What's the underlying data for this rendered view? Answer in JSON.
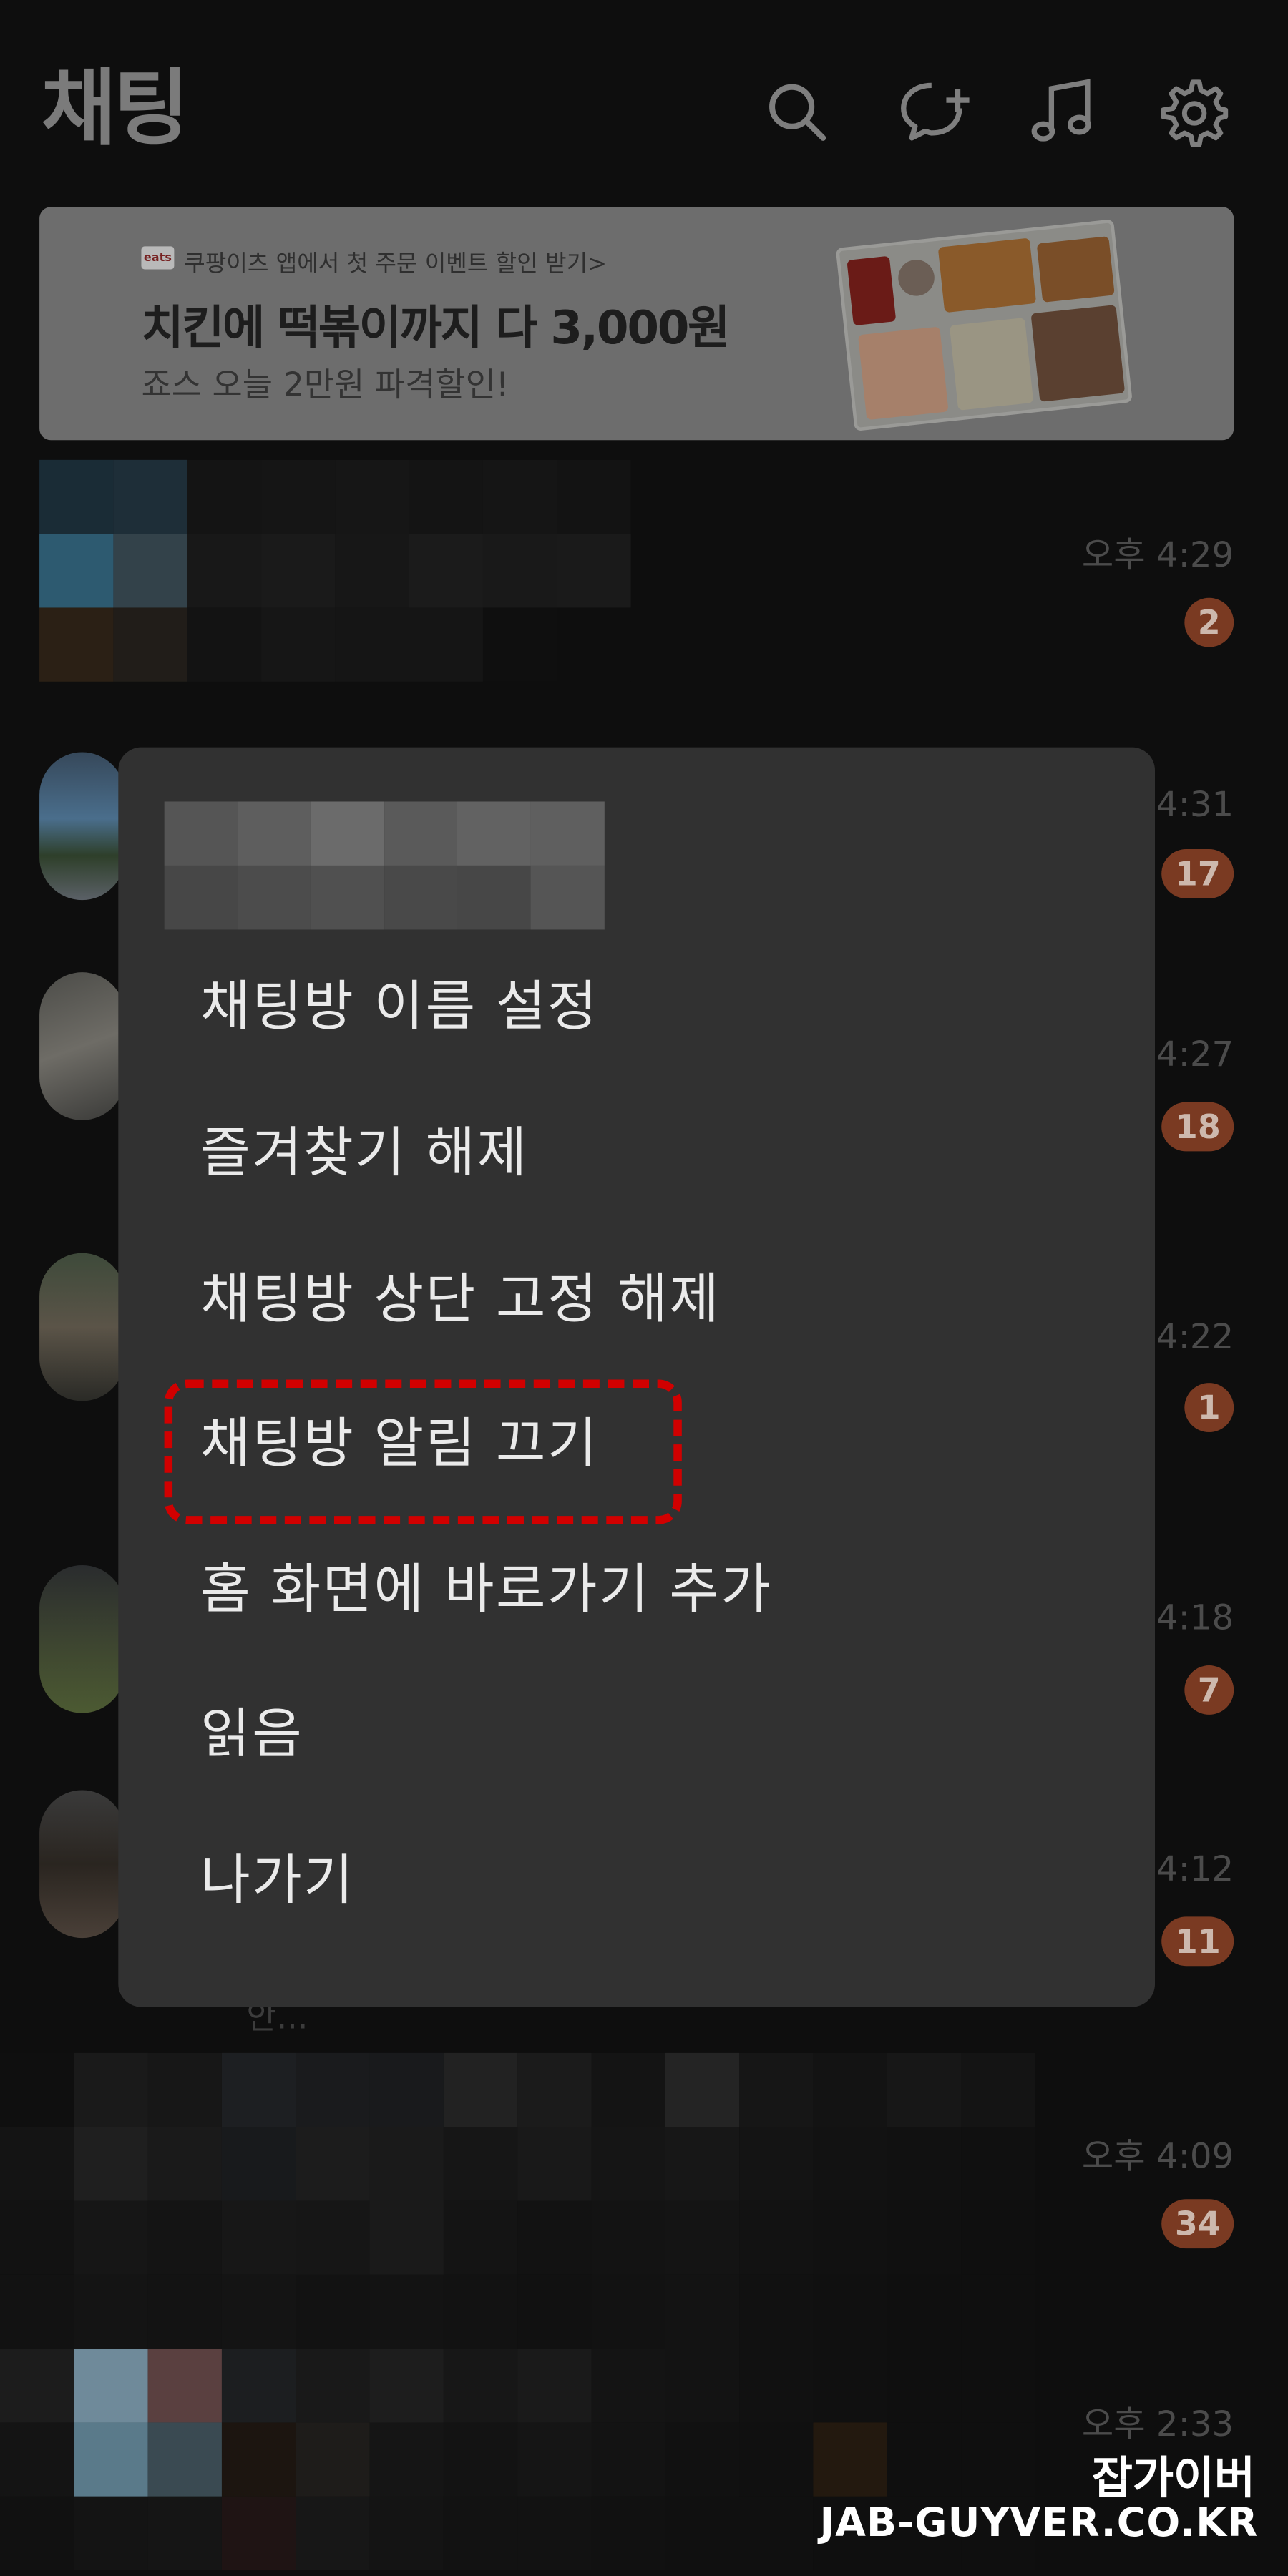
{
  "header": {
    "title": "채팅",
    "icons": [
      "search-icon",
      "new-chat-icon",
      "music-icon",
      "settings-icon"
    ]
  },
  "ad": {
    "brand_tag": "eats",
    "small": "쿠팡이츠 앱에서 첫 주문 이벤트 할인 받기>",
    "title": "치킨에 떡볶이까지 다 3,000원",
    "sub": "죠스 오늘 2만원 파격할인!"
  },
  "chats": [
    {
      "time": "오후 4:29",
      "unread": "2"
    },
    {
      "time": "4:31",
      "unread": "17"
    },
    {
      "time": "4:27",
      "unread": "18"
    },
    {
      "time": "4:22",
      "unread": "1"
    },
    {
      "time": "4:18",
      "unread": "7"
    },
    {
      "time": "4:12",
      "unread": "11"
    },
    {
      "time": "오후 4:09",
      "unread": "34"
    },
    {
      "time": "오후 2:33",
      "unread": ""
    }
  ],
  "chat_tail": "안...",
  "menu": {
    "items": [
      "채팅방 이름 설정",
      "즐겨찾기 해제",
      "채팅방 상단 고정 해제",
      "채팅방 알림 끄기",
      "홈 화면에 바로가기 추가",
      "읽음",
      "나가기"
    ],
    "highlighted_item": "채팅방 알림 끄기",
    "highlight_color": "#d10000"
  },
  "watermark": {
    "line1": "잡가이버",
    "line2": "JAB-GUYVER.CO.KR"
  }
}
